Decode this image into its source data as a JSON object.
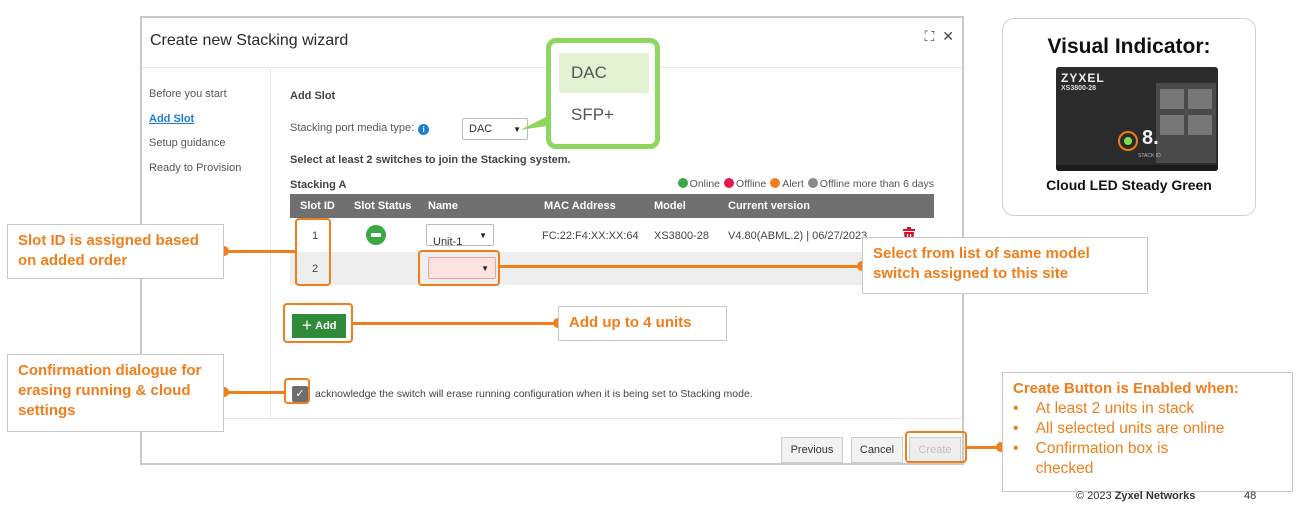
{
  "wizard": {
    "title": "Create new Stacking wizard",
    "steps": [
      "Before you start",
      "Add Slot",
      "Setup guidance",
      "Ready to Provision"
    ],
    "section_title": "Add Slot",
    "media_type_label": "Stacking port media type:",
    "media_type_value": "DAC",
    "select_hint": "Select at least 2 switches to join the Stacking system.",
    "stacking_label": "Stacking A",
    "legend": [
      {
        "label": "Online",
        "color": "#3aa845"
      },
      {
        "label": "Offline",
        "color": "#e8174a"
      },
      {
        "label": "Alert",
        "color": "#f07e1b"
      },
      {
        "label": "Offline more than 6 days",
        "color": "#8a8a8a"
      }
    ],
    "columns": [
      "Slot ID",
      "Slot Status",
      "Name",
      "MAC Address",
      "Model",
      "Current version"
    ],
    "rows": [
      {
        "slot": "1",
        "name": "Unit-1",
        "mac": "FC:22:F4:XX:XX:64",
        "model": "XS3800-28",
        "version": "V4.80(ABML.2) | 06/27/2023"
      },
      {
        "slot": "2",
        "name": "",
        "mac": "",
        "model": "",
        "version": ""
      }
    ],
    "add_label": "Add",
    "ack_text": "acknowledge the switch will erase running configuration when it is being set to Stacking mode.",
    "buttons": {
      "previous": "Previous",
      "cancel": "Cancel",
      "create": "Create"
    }
  },
  "dropdown_options": [
    "DAC",
    "SFP+"
  ],
  "callouts": {
    "slot_id": "Slot ID is assigned based on added order",
    "select_list": "Select from list of same model switch assigned to this site",
    "add_units": "Add up to 4 units",
    "confirmation": "Confirmation dialogue for erasing running & cloud settings",
    "create_title": "Create Button is Enabled when:",
    "create_items": [
      "At least 2 units in stack",
      "All selected units are online",
      "Confirmation box is checked"
    ]
  },
  "visual_indicator": {
    "title": "Visual Indicator:",
    "brand": "ZYXEL",
    "model": "XS3800-28",
    "digit": "8.",
    "stack_label": "STACK ID",
    "caption": "Cloud LED Steady Green"
  },
  "footer": {
    "copyright": "© 2023",
    "company": "Zyxel Networks",
    "page": "48"
  },
  "colors": {
    "accent": "#f07e1b",
    "online": "#3aa845",
    "add_button": "#2f8a3a",
    "highlight_green": "#8fd65f",
    "link": "#1a7fd3"
  }
}
